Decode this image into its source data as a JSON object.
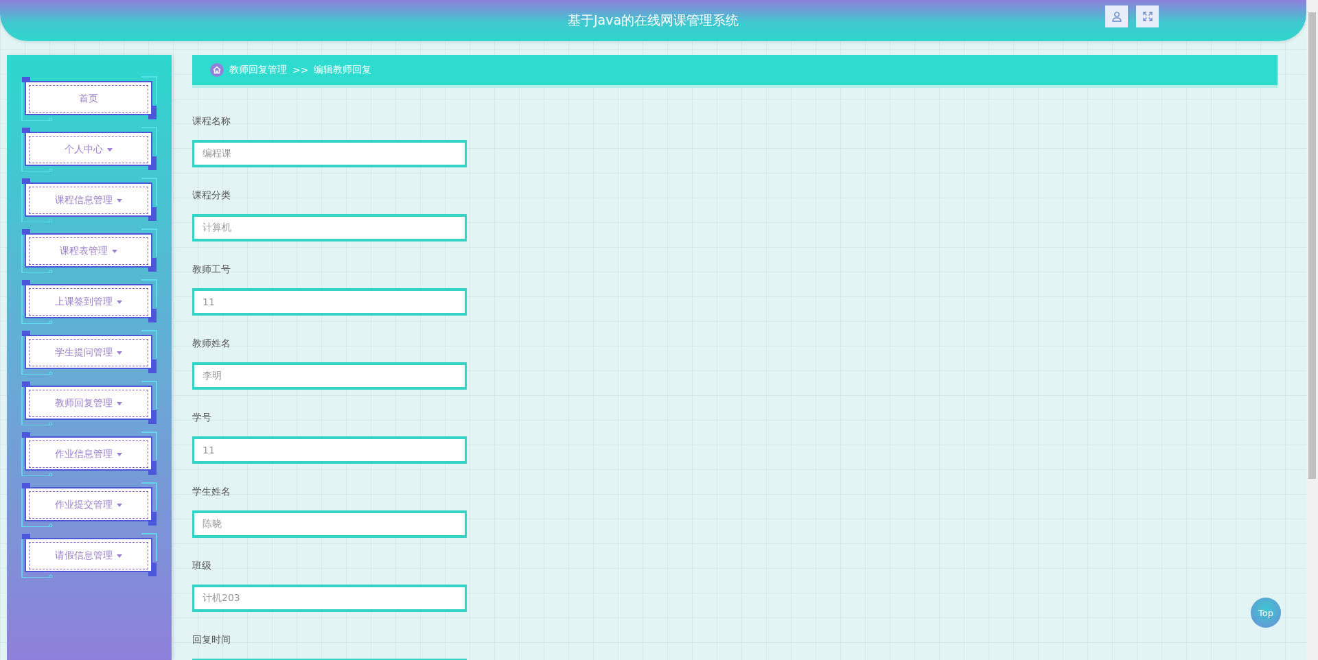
{
  "header": {
    "title": "基于Java的在线网课管理系统"
  },
  "sidebar": {
    "items": [
      {
        "label": "首页",
        "has_dropdown": false
      },
      {
        "label": "个人中心",
        "has_dropdown": true
      },
      {
        "label": "课程信息管理",
        "has_dropdown": true
      },
      {
        "label": "课程表管理",
        "has_dropdown": true
      },
      {
        "label": "上课签到管理",
        "has_dropdown": true
      },
      {
        "label": "学生提问管理",
        "has_dropdown": true
      },
      {
        "label": "教师回复管理",
        "has_dropdown": true
      },
      {
        "label": "作业信息管理",
        "has_dropdown": true
      },
      {
        "label": "作业提交管理",
        "has_dropdown": true
      },
      {
        "label": "请假信息管理",
        "has_dropdown": true
      }
    ]
  },
  "breadcrumb": {
    "parent": "教师回复管理",
    "separator": ">>",
    "current": "编辑教师回复"
  },
  "form": {
    "fields": [
      {
        "label": "课程名称",
        "value": "编程课",
        "disabled": true
      },
      {
        "label": "课程分类",
        "value": "计算机",
        "disabled": true
      },
      {
        "label": "教师工号",
        "value": "11",
        "disabled": true
      },
      {
        "label": "教师姓名",
        "value": "李明",
        "disabled": true
      },
      {
        "label": "学号",
        "value": "11",
        "disabled": true
      },
      {
        "label": "学生姓名",
        "value": "陈晓",
        "disabled": true
      },
      {
        "label": "班级",
        "value": "计机203",
        "disabled": true
      },
      {
        "label": "回复时间"
      }
    ]
  },
  "top_button": "Top"
}
